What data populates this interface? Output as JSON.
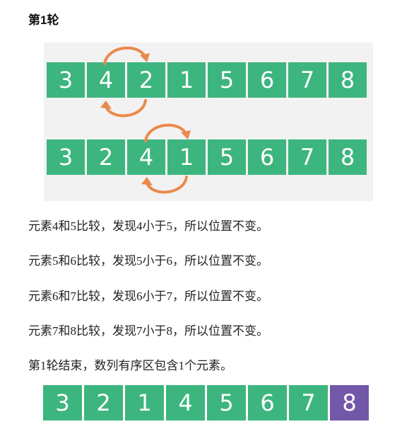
{
  "heading": "第1轮",
  "colors": {
    "cell_default": "#3db57f",
    "cell_sorted": "#7357a8",
    "arrow": "#ea8a4c"
  },
  "row1": {
    "cells": [
      "3",
      "4",
      "2",
      "1",
      "5",
      "6",
      "7",
      "8"
    ]
  },
  "row2": {
    "cells": [
      "3",
      "2",
      "4",
      "1",
      "5",
      "6",
      "7",
      "8"
    ]
  },
  "row3": {
    "cells": [
      "3",
      "2",
      "1",
      "4",
      "5",
      "6",
      "7",
      "8"
    ],
    "sorted_count": 1
  },
  "paragraphs": [
    "元素4和5比较，发现4小于5，所以位置不变。",
    "元素5和6比较，发现5小于6，所以位置不变。",
    "元素6和7比较，发现6小于7，所以位置不变。",
    "元素7和8比较，发现7小于8，所以位置不变。",
    "第1轮结束，数列有序区包含1个元素。"
  ]
}
